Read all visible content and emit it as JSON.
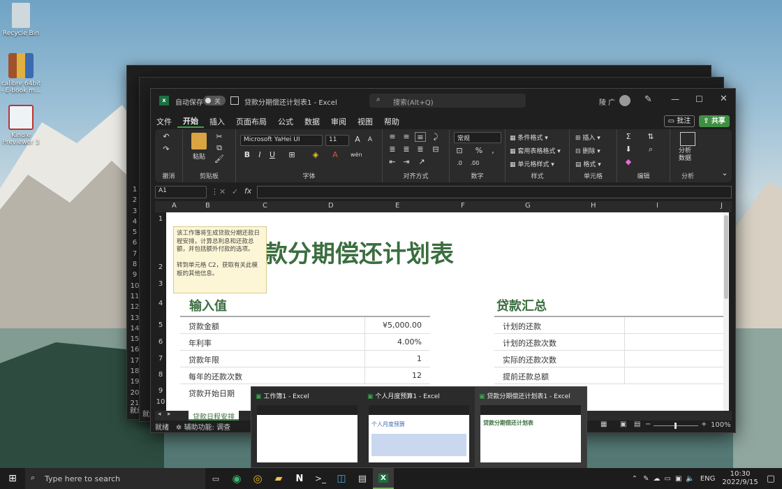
{
  "desktop": {
    "icons": [
      {
        "label": "Recycle Bin"
      },
      {
        "label": "calibre 64bit - E-book m..."
      },
      {
        "label": "Kindle Previewer 3"
      }
    ]
  },
  "bgwindows": {
    "rows": [
      "1",
      "2",
      "3",
      "4",
      "5",
      "6",
      "7",
      "8",
      "9",
      "10",
      "11",
      "12",
      "13",
      "14",
      "15",
      "16",
      "17",
      "18",
      "19",
      "20",
      "21"
    ],
    "status": "就绪"
  },
  "excel": {
    "autosave": "自动保存",
    "autosave_state": "关",
    "title": "贷款分期偿还计划表1 - Excel",
    "search_placeholder": "搜索(Alt+Q)",
    "user": "陵 广",
    "tabs": [
      "文件",
      "开始",
      "插入",
      "页面布局",
      "公式",
      "数据",
      "审阅",
      "视图",
      "帮助"
    ],
    "comment_btn": "批注",
    "share_btn": "共享",
    "groups": {
      "undo": "撤消",
      "clipboard": "剪贴板",
      "font": "字体",
      "align": "对齐方式",
      "number": "数字",
      "styles": "样式",
      "cells": "单元格",
      "edit": "编辑",
      "analysis": "分析"
    },
    "paste": "粘贴",
    "font_name": "Microsoft YaHei UI",
    "font_size": "11",
    "number_format": "常规",
    "styles_items": [
      "条件格式",
      "套用表格格式",
      "单元格样式"
    ],
    "cells_items": [
      "插入",
      "删除",
      "格式"
    ],
    "analyze": "分析\n数据",
    "namebox": "A1",
    "fx": "fx",
    "columns": [
      "A",
      "B",
      "C",
      "D",
      "E",
      "F",
      "G",
      "H",
      "I",
      "J"
    ],
    "rows": [
      "1",
      "2",
      "3",
      "4",
      "5",
      "6",
      "7",
      "8",
      "9",
      "10"
    ],
    "sheet_title": "款分期偿还计划表",
    "tooltip": "该工作簿将生成贷款分期还款日程安排，计算总利息和还款总额，并包括额外付款的选项。\n\n转到单元格 C2，获取有关此模板的其他信息。",
    "inputs_title": "输入值",
    "inputs": [
      {
        "label": "贷款金额",
        "value": "¥5,000.00"
      },
      {
        "label": "年利率",
        "value": "4.00%"
      },
      {
        "label": "贷款年限",
        "value": "1"
      },
      {
        "label": "每年的还款次数",
        "value": "12"
      },
      {
        "label": "贷款开始日期",
        "value": ""
      }
    ],
    "summary_title": "贷款汇总",
    "summary": [
      "计划的还款",
      "计划的还款次数",
      "实际的还款次数",
      "提前还款总额"
    ],
    "sheet_tab": "贷款日程安排",
    "status_ready": "就绪",
    "status_access": "辅助功能: 调查",
    "zoom": "100%"
  },
  "thumbnails": [
    {
      "title": "工作簿1 - Excel"
    },
    {
      "title": "个人月度预算1 - Excel",
      "preview_title": "个人月度预算"
    },
    {
      "title": "贷款分期偿还计划表1 - Excel",
      "preview_title": "贷款分期偿还计划表"
    }
  ],
  "taskbar": {
    "search_placeholder": "Type here to search",
    "lang": "ENG",
    "time": "10:30",
    "date": "2022/9/15"
  }
}
